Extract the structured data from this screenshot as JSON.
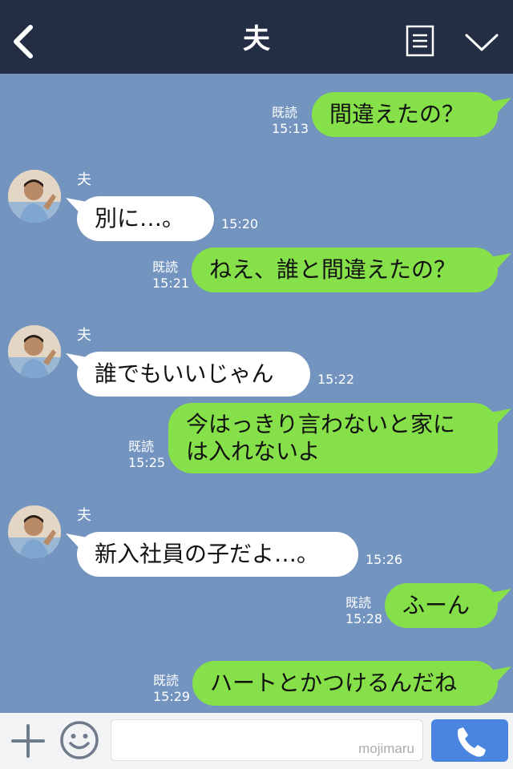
{
  "header": {
    "title": "夫",
    "back_icon": "chevron-left-icon",
    "menu_icon": "list-icon",
    "options_icon": "chevron-down-icon",
    "background": "#232d44"
  },
  "chat": {
    "background": "#7494c0",
    "outgoing_bubble_color": "#86e049",
    "incoming_bubble_color": "#ffffff",
    "messages": [
      {
        "direction": "out",
        "text": "間違えたの？",
        "read": "既読",
        "time": "15:13"
      },
      {
        "direction": "in",
        "sender": "夫",
        "text": "別に…。",
        "time": "15:20"
      },
      {
        "direction": "out",
        "text": "ねえ、誰と間違えたの？",
        "read": "既読",
        "time": "15:21"
      },
      {
        "direction": "in",
        "sender": "夫",
        "text": "誰でもいいじゃん",
        "time": "15:22"
      },
      {
        "direction": "out",
        "lines": [
          "今はっきり言わないと家に",
          "は入れないよ"
        ],
        "read": "既読",
        "time": "15:25"
      },
      {
        "direction": "in",
        "sender": "夫",
        "text": "新入社員の子だよ…。",
        "time": "15:26"
      },
      {
        "direction": "out",
        "text": "ふーん",
        "read": "既読",
        "time": "15:28"
      },
      {
        "direction": "out",
        "text": "ハートとかつけるんだね",
        "read": "既読",
        "time": "15:29"
      }
    ]
  },
  "footer": {
    "plus_icon": "plus-icon",
    "emoji_icon": "smile-icon",
    "input_value": "",
    "watermark": "mojimaru",
    "call_icon": "phone-icon",
    "call_button_color": "#4a86e0"
  }
}
